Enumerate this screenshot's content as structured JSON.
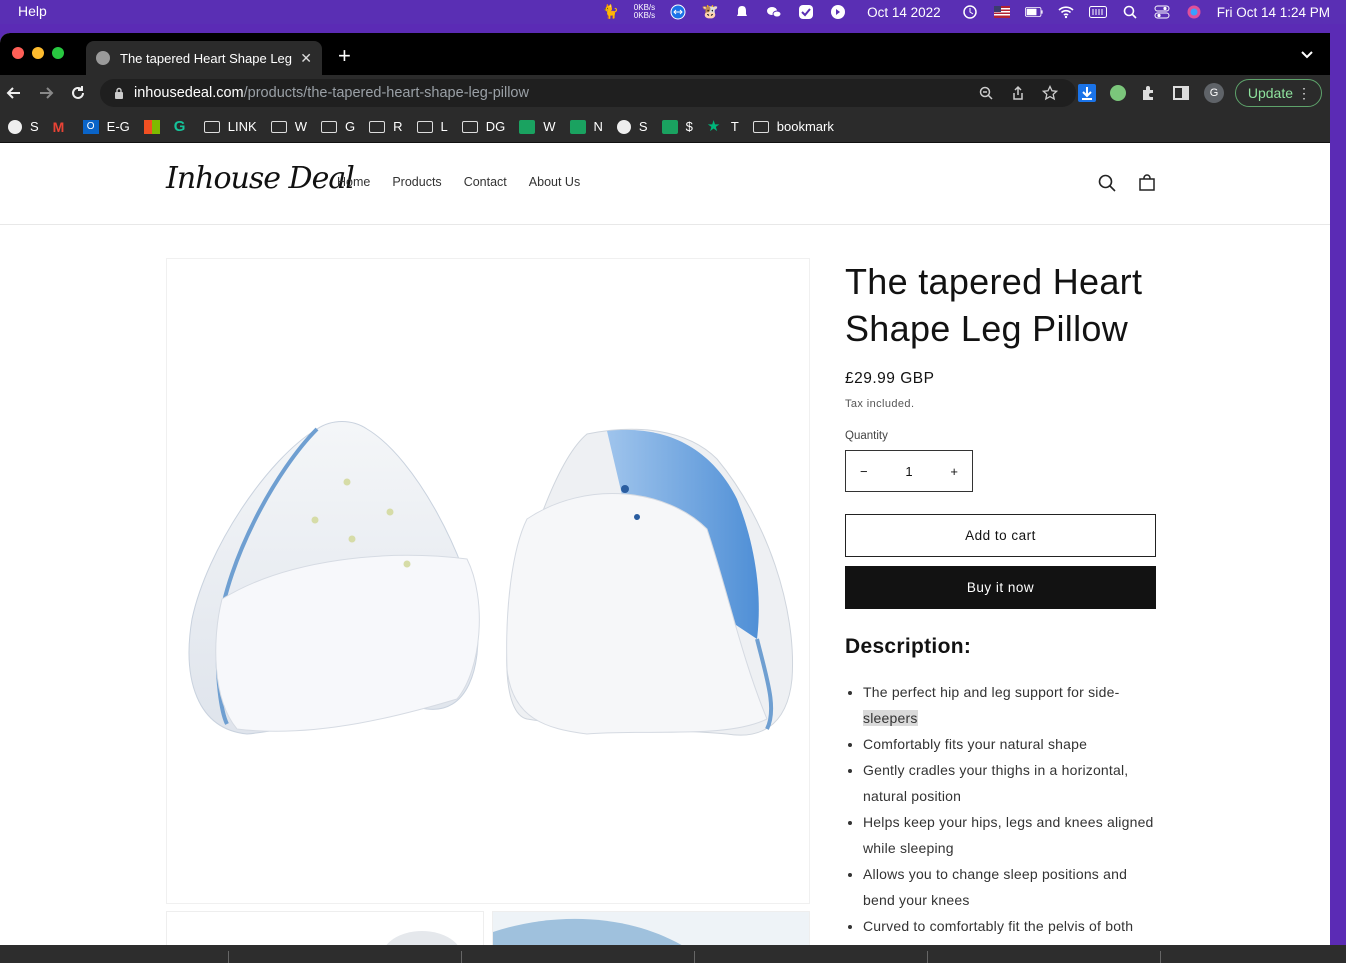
{
  "menubar": {
    "app_menu": "Help",
    "net_up": "0KB/s",
    "net_down": "0KB/s",
    "date_widget": "Oct 14 2022",
    "clock": "Fri Oct 14  1:24 PM"
  },
  "browser": {
    "tab_title": "The tapered Heart Shape Leg Pillow",
    "url_host": "inhousedeal.com",
    "url_path": "/products/the-tapered-heart-shape-leg-pillow",
    "profile_initial": "G",
    "update_label": "Update",
    "bookmarks": [
      "S",
      "",
      "E-G",
      "",
      "",
      "LINK",
      "W",
      "G",
      "R",
      "L",
      "DG",
      "W",
      "N",
      "S",
      "$",
      "T",
      "bookmark"
    ]
  },
  "site": {
    "logo": "Inhouse Deal",
    "nav": [
      "Home",
      "Products",
      "Contact",
      "About Us"
    ]
  },
  "product": {
    "title": "The tapered Heart Shape Leg Pillow",
    "price": "£29.99 GBP",
    "tax_note": "Tax included.",
    "quantity_label": "Quantity",
    "quantity_value": "1",
    "minus": "−",
    "plus": "+",
    "add_to_cart": "Add to cart",
    "buy_now": "Buy it now",
    "description_heading": "Description:",
    "description_items": [
      "The perfect hip and leg support for side-",
      "Comfortably fits your natural shape",
      "Gently cradles your thighs in a horizontal, natural position",
      "Helps keep your hips, legs and knees aligned while sleeping",
      "Allows you to change sleep positions and bend your knees",
      "Curved to comfortably fit the pelvis of both"
    ],
    "description_item1_highlight": "sleepers"
  },
  "colors": {
    "menubar": "#5a2fb4",
    "primary_button": "#121212",
    "update_green": "#8ee29d"
  }
}
